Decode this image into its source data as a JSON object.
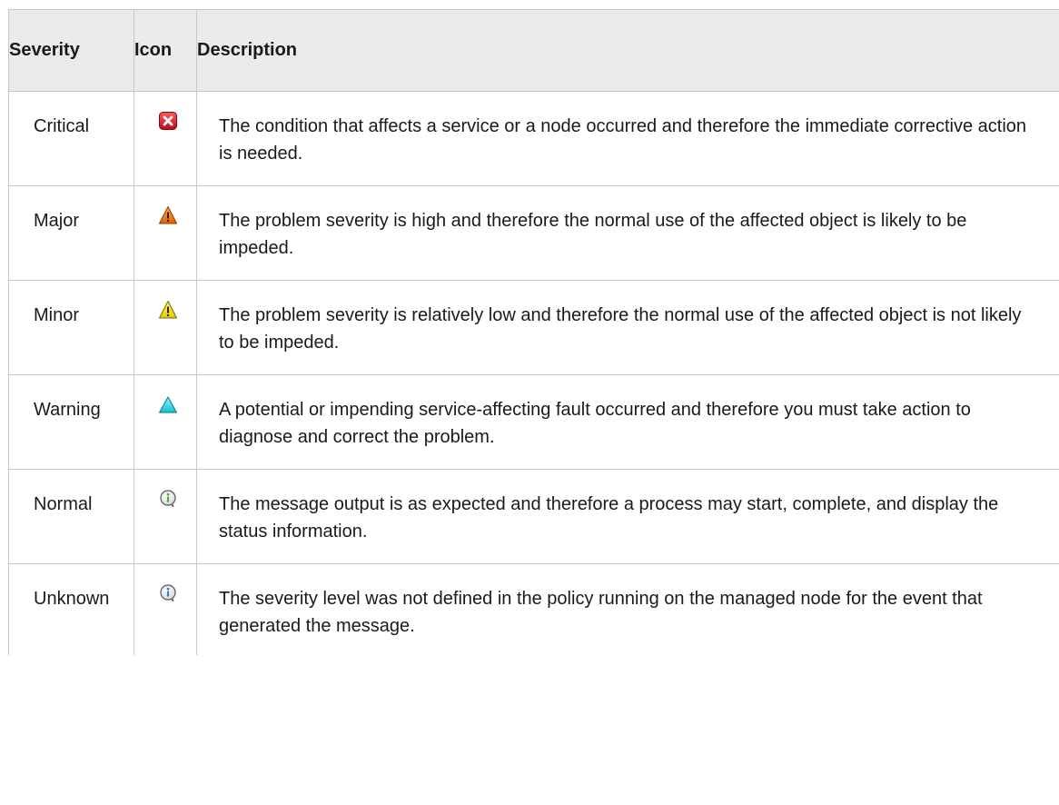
{
  "table": {
    "headers": {
      "severity": "Severity",
      "icon": "Icon",
      "description": "Description"
    },
    "rows": [
      {
        "severity": "Critical",
        "icon": "critical-icon",
        "icon_color": "#e0202a",
        "description": "The condition that affects a service or a node occurred and therefore the immediate corrective action is needed."
      },
      {
        "severity": "Major",
        "icon": "major-icon",
        "icon_color": "#f07a10",
        "description": "The problem severity is high and therefore the normal use of the affected object is likely to be impeded."
      },
      {
        "severity": "Minor",
        "icon": "minor-icon",
        "icon_color": "#f2e600",
        "description": "The problem severity is relatively low and therefore the normal use of the affected object is not likely to be impeded."
      },
      {
        "severity": "Warning",
        "icon": "warning-icon",
        "icon_color": "#2fd6e6",
        "description": "A potential or impending service-affecting fault occurred and therefore you must take action to diagnose and correct the problem."
      },
      {
        "severity": "Normal",
        "icon": "normal-info-icon",
        "icon_color": "#7ccc2a",
        "description": "The message output is as expected and therefore a process may start, complete, and display the status information."
      },
      {
        "severity": "Unknown",
        "icon": "unknown-info-icon",
        "icon_color": "#3a8ee6",
        "description": "The severity level was not defined in the policy running on the managed node for the event that generated the message."
      }
    ]
  }
}
